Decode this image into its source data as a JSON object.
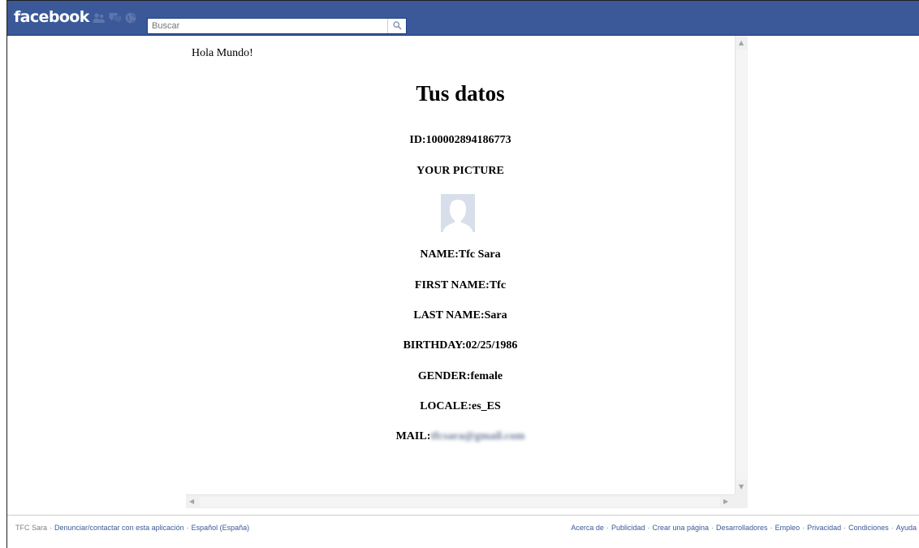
{
  "header": {
    "logo": "facebook",
    "search_placeholder": "Buscar",
    "brand_color": "#3b5998",
    "icons": [
      "friend-requests-icon",
      "messages-icon",
      "notifications-icon",
      "search-icon"
    ]
  },
  "app": {
    "greeting": "Hola Mundo!",
    "title": "Tus datos",
    "id_label": "ID:",
    "id_value": "100002894186773",
    "picture_heading": "YOUR PICTURE",
    "name_label": "NAME:",
    "name_value": "Tfc Sara",
    "first_name_label": "FIRST NAME:",
    "first_name_value": "Tfc",
    "last_name_label": "LAST NAME:",
    "last_name_value": "Sara",
    "birthday_label": "BIRTHDAY:",
    "birthday_value": "02/25/1986",
    "gender_label": "GENDER:",
    "gender_value": "female",
    "locale_label": "LOCALE:",
    "locale_value": "es_ES",
    "mail_label": "MAIL:",
    "mail_value": "tfcsara@gmail.com"
  },
  "footer": {
    "left": [
      "TFC Sara",
      "Denunciar/contactar con esta aplicación",
      "Español (España)"
    ],
    "right": [
      "Acerca de",
      "Publicidad",
      "Crear una página",
      "Desarrolladores",
      "Empleo",
      "Privacidad",
      "Condiciones",
      "Ayuda"
    ]
  }
}
